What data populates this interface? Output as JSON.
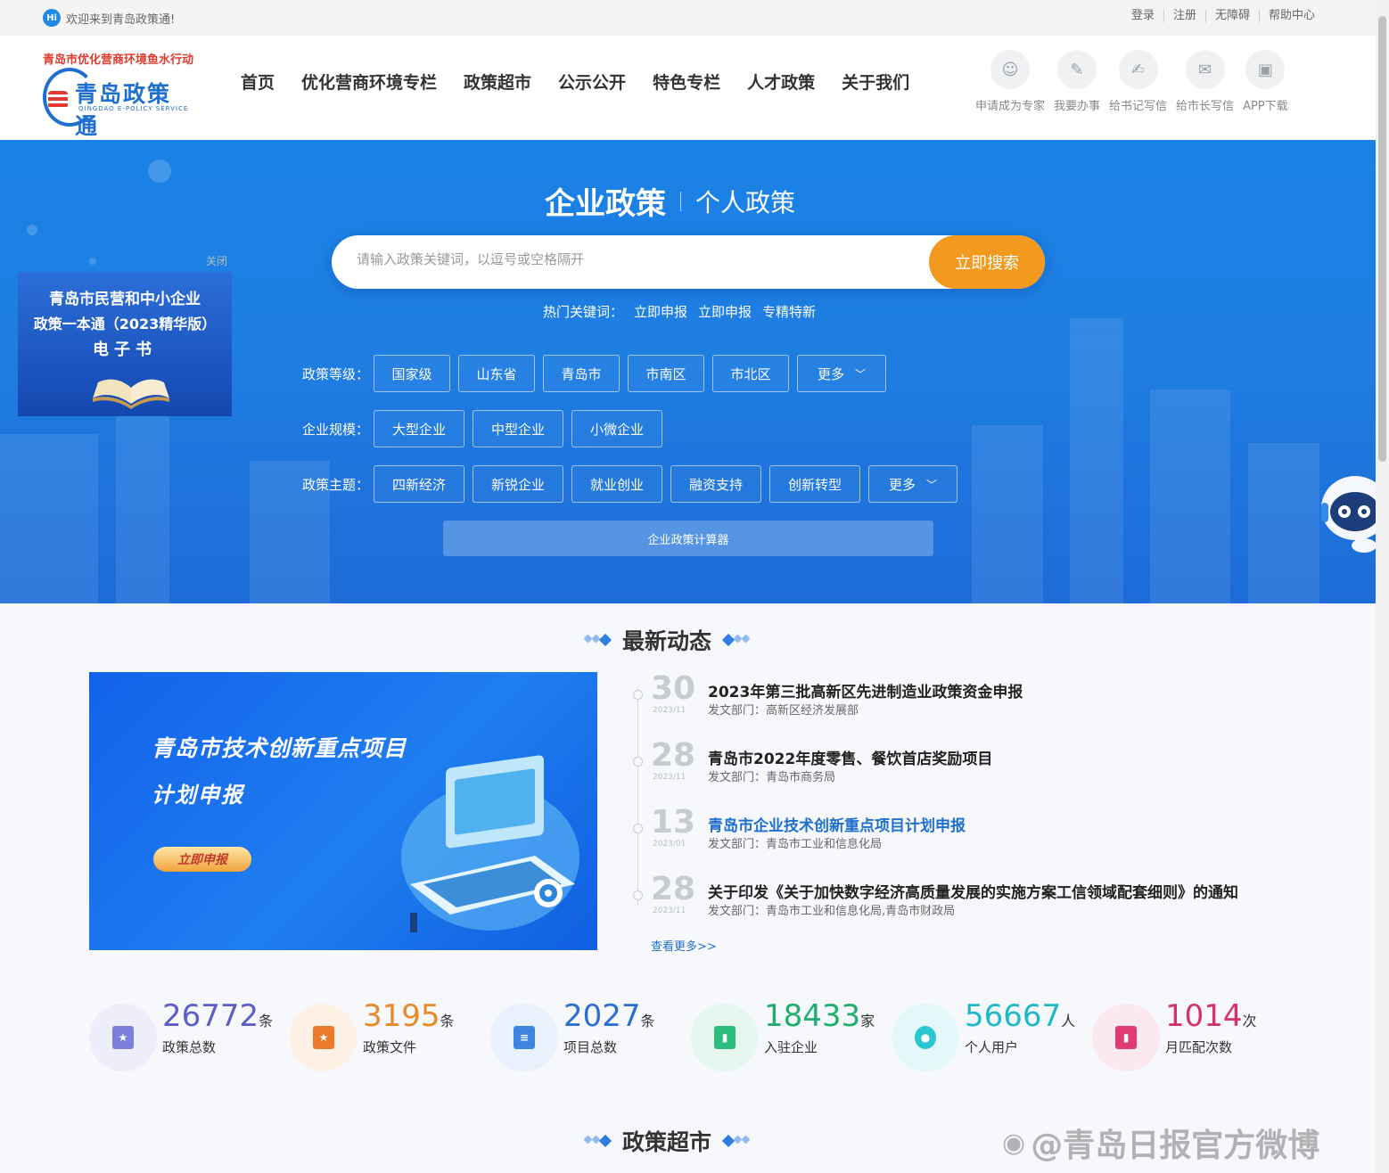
{
  "topbar": {
    "welcome": "欢迎来到青岛政策通!",
    "links": [
      "登录",
      "注册",
      "无障碍",
      "帮助中心"
    ]
  },
  "header": {
    "slogan": "青岛市优化营商环境鱼水行动",
    "logo_text": "青岛政策通",
    "logo_sub": "QINGDAO E-POLICY SERVICE",
    "nav": [
      "首页",
      "优化营商环境专栏",
      "政策超市",
      "公示公开",
      "特色专栏",
      "人才政策",
      "关于我们"
    ],
    "quick": [
      "申请成为专家",
      "我要办事",
      "给书记写信",
      "给市长写信",
      "APP下载"
    ]
  },
  "hero": {
    "tab_active": "企业政策",
    "tab_inactive": "个人政策",
    "search_placeholder": "请输入政策关键词，以逗号或空格隔开",
    "search_button": "立即搜索",
    "hot_label": "热门关键词：",
    "hot_words": [
      "立即申报",
      "立即申报",
      "专精特新"
    ],
    "level_label": "政策等级：",
    "levels": [
      "国家级",
      "山东省",
      "青岛市",
      "市南区",
      "市北区",
      "更多"
    ],
    "scale_label": "企业规模：",
    "scales": [
      "大型企业",
      "中型企业",
      "小微企业"
    ],
    "topic_label": "政策主题：",
    "topics": [
      "四新经济",
      "新锐企业",
      "就业创业",
      "融资支持",
      "创新转型",
      "更多"
    ],
    "calculator": "企业政策计算器"
  },
  "ebook": {
    "close": "关闭",
    "line1": "青岛市民营和中小企业",
    "line2": "政策一本通（2023精华版）",
    "line3": "电子书"
  },
  "news": {
    "title": "最新动态",
    "banner_line1": "青岛市技术创新重点项目",
    "banner_line2": "计划申报",
    "banner_button": "立即申报",
    "items": [
      {
        "day": "30",
        "ym": "2023/11",
        "title": "2023年第三批高新区先进制造业政策资金申报",
        "dept": "发文部门：高新区经济发展部"
      },
      {
        "day": "28",
        "ym": "2023/11",
        "title": "青岛市2022年度零售、餐饮首店奖励项目",
        "dept": "发文部门：青岛市商务局"
      },
      {
        "day": "13",
        "ym": "2023/01",
        "title": "青岛市企业技术创新重点项目计划申报",
        "dept": "发文部门：青岛市工业和信息化局"
      },
      {
        "day": "28",
        "ym": "2023/11",
        "title": "关于印发《关于加快数字经济高质量发展的实施方案工信领域配套细则》的通知",
        "dept": "发文部门：青岛市工业和信息化局,青岛市财政局"
      }
    ],
    "more": "查看更多>>"
  },
  "stats": [
    {
      "num": "26772",
      "unit": "条",
      "label": "政策总数",
      "color": "#5b5fc7",
      "bg": "#eeeefb",
      "icon_bg": "#7b7fd9",
      "icon": "★"
    },
    {
      "num": "3195",
      "unit": "条",
      "label": "政策文件",
      "color": "#e8892a",
      "bg": "#fdf1e6",
      "icon_bg": "#ec7a2a",
      "icon": "★"
    },
    {
      "num": "2027",
      "unit": "条",
      "label": "项目总数",
      "color": "#2b6fcf",
      "bg": "#e9f1fc",
      "icon_bg": "#3f86e0",
      "icon": "≡"
    },
    {
      "num": "18433",
      "unit": "家",
      "label": "入驻企业",
      "color": "#1fae6e",
      "bg": "#e5f7ee",
      "icon_bg": "#2cbd7e",
      "icon": "▮"
    },
    {
      "num": "56667",
      "unit": "人",
      "label": "个人用户",
      "color": "#1fb8c8",
      "bg": "#e4f7f9",
      "icon_bg": "#2cc6d2",
      "icon": "●"
    },
    {
      "num": "1014",
      "unit": "次",
      "label": "月匹配次数",
      "color": "#d4326b",
      "bg": "#fbe9ef",
      "icon_bg": "#e03c72",
      "icon": "▮"
    }
  ],
  "market": {
    "title": "政策超市"
  },
  "watermark": "@青岛日报官方微博"
}
